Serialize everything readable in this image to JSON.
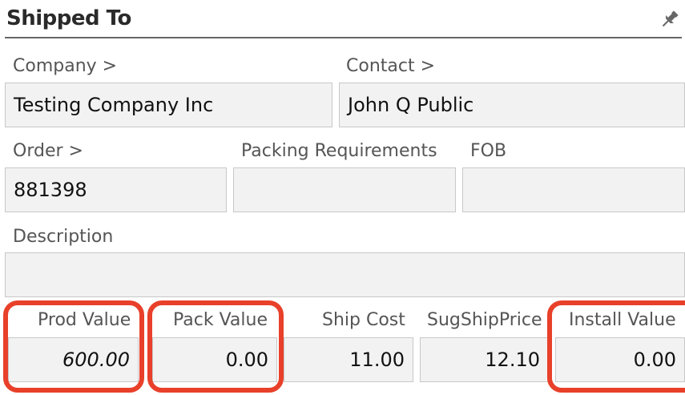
{
  "panel": {
    "title": "Shipped To",
    "pin_icon": "pin-icon"
  },
  "labels": {
    "company": "Company >",
    "contact": "Contact >",
    "order": "Order >",
    "packing_requirements": "Packing Requirements",
    "fob": "FOB",
    "description": "Description",
    "prod_value": "Prod Value",
    "pack_value": "Pack Value",
    "ship_cost": "Ship Cost",
    "sug_ship_price": "SugShipPrice",
    "install_value": "Install Value"
  },
  "fields": {
    "company": "Testing Company Inc",
    "contact": "John Q Public",
    "order": "881398",
    "packing_requirements": "",
    "fob": "",
    "description": "",
    "prod_value": "600.00",
    "pack_value": "0.00",
    "ship_cost": "11.00",
    "sug_ship_price": "12.10",
    "install_value": "0.00"
  },
  "colors": {
    "highlight": "#e8402a",
    "field_bg": "#f2f2f2"
  }
}
